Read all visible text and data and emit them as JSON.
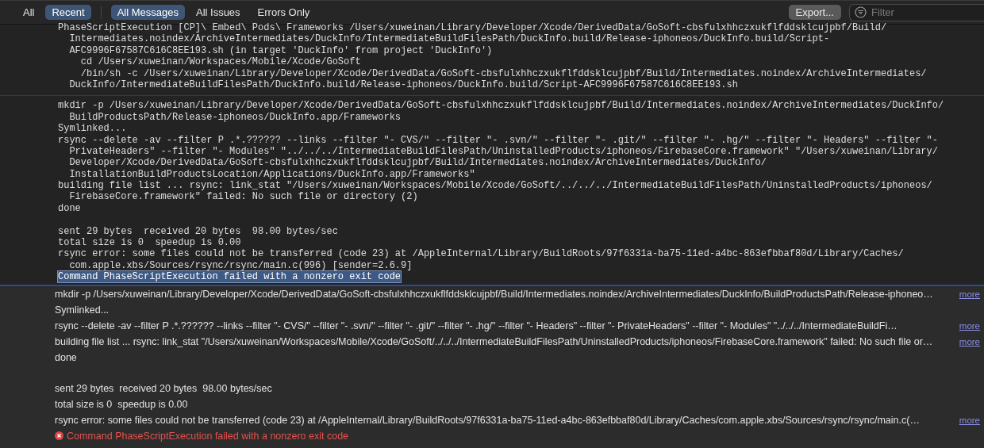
{
  "toolbar": {
    "scope_tabs": [
      {
        "label": "All",
        "selected": false
      },
      {
        "label": "Recent",
        "selected": true
      }
    ],
    "filter_tabs": [
      {
        "label": "All Messages",
        "selected": true
      },
      {
        "label": "All Issues",
        "selected": false
      },
      {
        "label": "Errors Only",
        "selected": false
      }
    ],
    "export_button": "Export...",
    "filter": {
      "placeholder": "Filter"
    }
  },
  "log_blocks": [
    {
      "lines": [
        {
          "kind": "first",
          "selected": false,
          "text": "PhaseScriptExecution [CP]\\ Embed\\ Pods\\ Frameworks /Users/xuweinan/Library/Developer/Xcode/DerivedData/GoSoft-cbsfulxhhczxukflfddsklcujpbf/Build/"
        },
        {
          "kind": "wrap",
          "selected": false,
          "text": "Intermediates.noindex/ArchiveIntermediates/DuckInfo/IntermediateBuildFilesPath/DuckInfo.build/Release-iphoneos/DuckInfo.build/Script-"
        },
        {
          "kind": "wrap",
          "selected": false,
          "text": "AFC9996F67587C616C8EE193.sh (in target 'DuckInfo' from project 'DuckInfo')"
        },
        {
          "kind": "sub",
          "selected": false,
          "text": "cd /Users/xuweinan/Workspaces/Mobile/Xcode/GoSoft"
        },
        {
          "kind": "sub",
          "selected": false,
          "text": "/bin/sh -c /Users/xuweinan/Library/Developer/Xcode/DerivedData/GoSoft-cbsfulxhhczxukflfddsklcujpbf/Build/Intermediates.noindex/ArchiveIntermediates/"
        },
        {
          "kind": "wrap",
          "selected": false,
          "text": "DuckInfo/IntermediateBuildFilesPath/DuckInfo.build/Release-iphoneos/DuckInfo.build/Script-AFC9996F67587C616C8EE193.sh"
        }
      ]
    },
    {
      "lines": [
        {
          "kind": "first",
          "selected": false,
          "text": "mkdir -p /Users/xuweinan/Library/Developer/Xcode/DerivedData/GoSoft-cbsfulxhhczxukflfddsklcujpbf/Build/Intermediates.noindex/ArchiveIntermediates/DuckInfo/"
        },
        {
          "kind": "wrap",
          "selected": false,
          "text": "BuildProductsPath/Release-iphoneos/DuckInfo.app/Frameworks"
        },
        {
          "kind": "first",
          "selected": false,
          "text": "Symlinked..."
        },
        {
          "kind": "first",
          "selected": false,
          "text": "rsync --delete -av --filter P .*.?????? --links --filter \"- CVS/\" --filter \"- .svn/\" --filter \"- .git/\" --filter \"- .hg/\" --filter \"- Headers\" --filter \"-"
        },
        {
          "kind": "wrap",
          "selected": false,
          "text": "PrivateHeaders\" --filter \"- Modules\" \"../../../IntermediateBuildFilesPath/UninstalledProducts/iphoneos/FirebaseCore.framework\" \"/Users/xuweinan/Library/"
        },
        {
          "kind": "wrap",
          "selected": false,
          "text": "Developer/Xcode/DerivedData/GoSoft-cbsfulxhhczxukflfddsklcujpbf/Build/Intermediates.noindex/ArchiveIntermediates/DuckInfo/"
        },
        {
          "kind": "wrap",
          "selected": false,
          "text": "InstallationBuildProductsLocation/Applications/DuckInfo.app/Frameworks\""
        },
        {
          "kind": "first",
          "selected": false,
          "text": "building file list ... rsync: link_stat \"/Users/xuweinan/Workspaces/Mobile/Xcode/GoSoft/../../../IntermediateBuildFilesPath/UninstalledProducts/iphoneos/"
        },
        {
          "kind": "wrap",
          "selected": false,
          "text": "FirebaseCore.framework\" failed: No such file or directory (2)"
        },
        {
          "kind": "first",
          "selected": false,
          "text": "done"
        },
        {
          "kind": "blank",
          "selected": false
        },
        {
          "kind": "first",
          "selected": false,
          "text": "sent 29 bytes  received 20 bytes  98.00 bytes/sec"
        },
        {
          "kind": "first",
          "selected": false,
          "text": "total size is 0  speedup is 0.00"
        },
        {
          "kind": "first",
          "selected": false,
          "text": "rsync error: some files could not be transferred (code 23) at /AppleInternal/Library/BuildRoots/97f6331a-ba75-11ed-a4bc-863efbbaf80d/Library/Caches/"
        },
        {
          "kind": "wrap",
          "selected": false,
          "text": "com.apple.xbs/Sources/rsync/rsync/main.c(996) [sender=2.6.9]"
        },
        {
          "kind": "first",
          "selected": true,
          "text": "Command PhaseScriptExecution failed with a nonzero exit code"
        }
      ]
    }
  ],
  "messages": [
    {
      "kind": "text",
      "text": "mkdir -p /Users/xuweinan/Library/Developer/Xcode/DerivedData/GoSoft-cbsfulxhhczxukflfddsklcujpbf/Build/Intermediates.noindex/ArchiveIntermediates/DuckInfo/BuildProductsPath/Release-iphoneo…",
      "link": "more"
    },
    {
      "kind": "text",
      "text": "Symlinked..."
    },
    {
      "kind": "text",
      "text": "rsync --delete -av --filter P .*.?????? --links --filter \"- CVS/\" --filter \"- .svn/\" --filter \"- .git/\" --filter \"- .hg/\" --filter \"- Headers\" --filter \"- PrivateHeaders\" --filter \"- Modules\" \"../../../IntermediateBuildFi…",
      "link": "more"
    },
    {
      "kind": "text",
      "text": "building file list ... rsync: link_stat \"/Users/xuweinan/Workspaces/Mobile/Xcode/GoSoft/../../../IntermediateBuildFilesPath/UninstalledProducts/iphoneos/FirebaseCore.framework\" failed: No such file or…",
      "link": "more"
    },
    {
      "kind": "text",
      "text": "done"
    },
    {
      "kind": "blank"
    },
    {
      "kind": "text",
      "text": "sent 29 bytes  received 20 bytes  98.00 bytes/sec"
    },
    {
      "kind": "text",
      "text": "total size is 0  speedup is 0.00"
    },
    {
      "kind": "text",
      "text": "rsync error: some files could not be transferred (code 23) at /AppleInternal/Library/BuildRoots/97f6331a-ba75-11ed-a4bc-863efbbaf80d/Library/Caches/com.apple.xbs/Sources/rsync/rsync/main.c(…",
      "link": "more"
    },
    {
      "kind": "error",
      "text": "Command PhaseScriptExecution failed with a nonzero exit code"
    }
  ]
}
